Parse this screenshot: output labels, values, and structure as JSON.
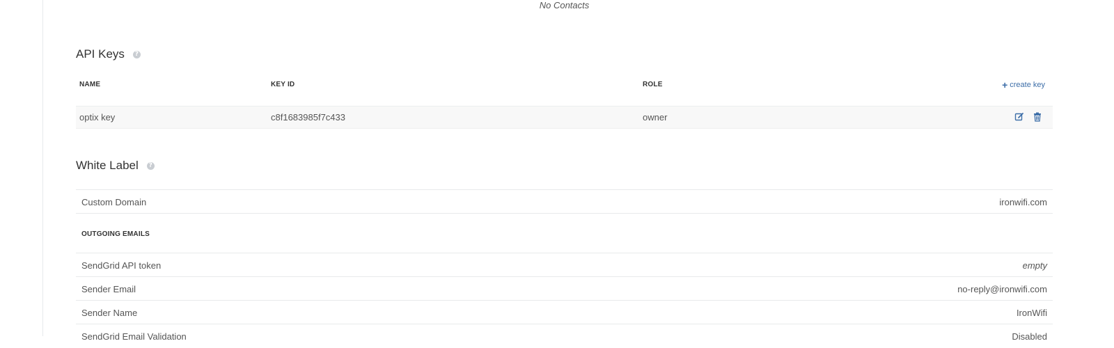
{
  "contacts": {
    "empty_text": "No Contacts"
  },
  "api_keys": {
    "title": "API Keys",
    "columns": {
      "name": "NAME",
      "key_id": "KEY ID",
      "role": "ROLE"
    },
    "create_label": "create key",
    "rows": [
      {
        "name": "optix key",
        "key_id": "c8f1683985f7c433",
        "role": "owner"
      }
    ]
  },
  "white_label": {
    "title": "White Label",
    "custom_domain": {
      "label": "Custom Domain",
      "value": "ironwifi.com"
    },
    "outgoing_heading": "OUTGOING EMAILS",
    "sendgrid_token": {
      "label": "SendGrid API token",
      "value": "empty"
    },
    "sender_email": {
      "label": "Sender Email",
      "value": "no-reply@ironwifi.com"
    },
    "sender_name": {
      "label": "Sender Name",
      "value": "IronWifi"
    },
    "sendgrid_validation": {
      "label": "SendGrid Email Validation",
      "value": "Disabled"
    }
  },
  "colors": {
    "link": "#3d6ea8",
    "empty": "#d01d4e"
  }
}
